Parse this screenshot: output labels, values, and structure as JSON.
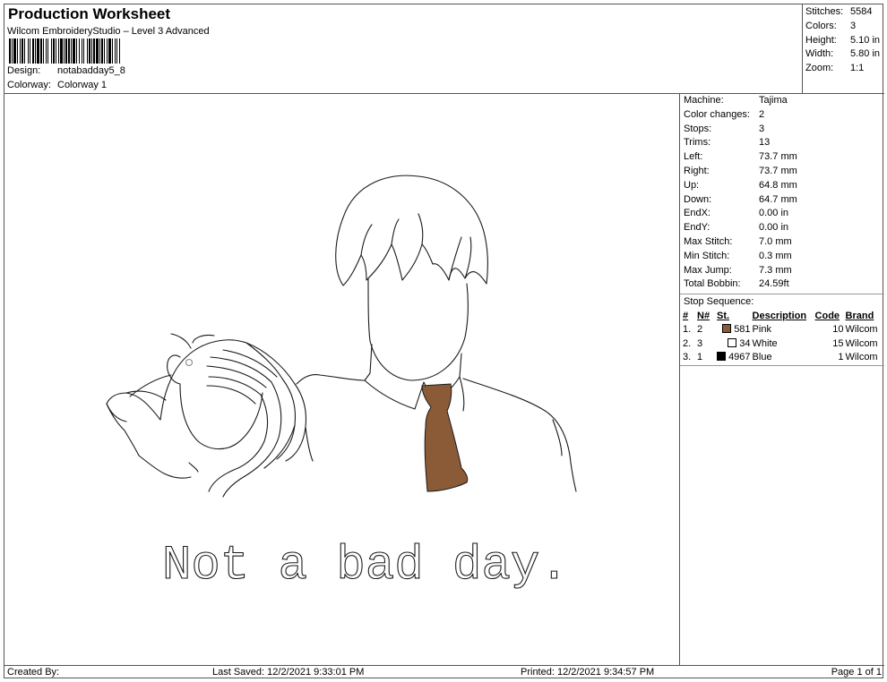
{
  "header": {
    "title": "Production Worksheet",
    "subtitle": "Wilcom EmbroideryStudio – Level 3 Advanced",
    "design_label": "Design:",
    "design_value": "notabadday5_8",
    "colorway_label": "Colorway:",
    "colorway_value": "Colorway 1"
  },
  "stats": [
    {
      "label": "Stitches:",
      "value": "5584"
    },
    {
      "label": "Colors:",
      "value": "3"
    },
    {
      "label": "Height:",
      "value": "5.10 in"
    },
    {
      "label": "Width:",
      "value": "5.80 in"
    },
    {
      "label": "Zoom:",
      "value": "1:1"
    }
  ],
  "machine_info": [
    {
      "label": "Machine:",
      "value": "Tajima"
    },
    {
      "label": "Color changes:",
      "value": "2"
    },
    {
      "label": "Stops:",
      "value": "3"
    },
    {
      "label": "Trims:",
      "value": "13"
    },
    {
      "label": "Left:",
      "value": "73.7 mm"
    },
    {
      "label": "Right:",
      "value": "73.7 mm"
    },
    {
      "label": "Up:",
      "value": "64.8 mm"
    },
    {
      "label": "Down:",
      "value": "64.7 mm"
    },
    {
      "label": "EndX:",
      "value": "0.00 in"
    },
    {
      "label": "EndY:",
      "value": "0.00 in"
    },
    {
      "label": "Max Stitch:",
      "value": "7.0 mm"
    },
    {
      "label": "Min Stitch:",
      "value": "0.3 mm"
    },
    {
      "label": "Max Jump:",
      "value": "7.3 mm"
    },
    {
      "label": "Total Bobbin:",
      "value": "24.59ft"
    }
  ],
  "stop_sequence": {
    "title": "Stop Sequence:",
    "headers": {
      "index": "#",
      "n": "N#",
      "st": "St.",
      "description": "Description",
      "code": "Code",
      "brand": "Brand"
    },
    "rows": [
      {
        "index": "1.",
        "n": "2",
        "color": "#8a5a3a",
        "st": "581",
        "description": "Pink",
        "code": "10",
        "brand": "Wilcom"
      },
      {
        "index": "2.",
        "n": "3",
        "color": "#ffffff",
        "st": "34",
        "description": "White",
        "code": "15",
        "brand": "Wilcom"
      },
      {
        "index": "3.",
        "n": "1",
        "color": "#000000",
        "st": "4967",
        "description": "Blue",
        "code": "1",
        "brand": "Wilcom"
      }
    ]
  },
  "design_text": "Not a bad day.",
  "colors": {
    "tie": "#8b5a36",
    "line": "#1a1a1a"
  },
  "footer": {
    "created_by": "Created By:",
    "last_saved": "Last Saved: 12/2/2021 9:33:01 PM",
    "printed": "Printed: 12/2/2021 9:34:57 PM",
    "page": "Page 1 of 1"
  }
}
